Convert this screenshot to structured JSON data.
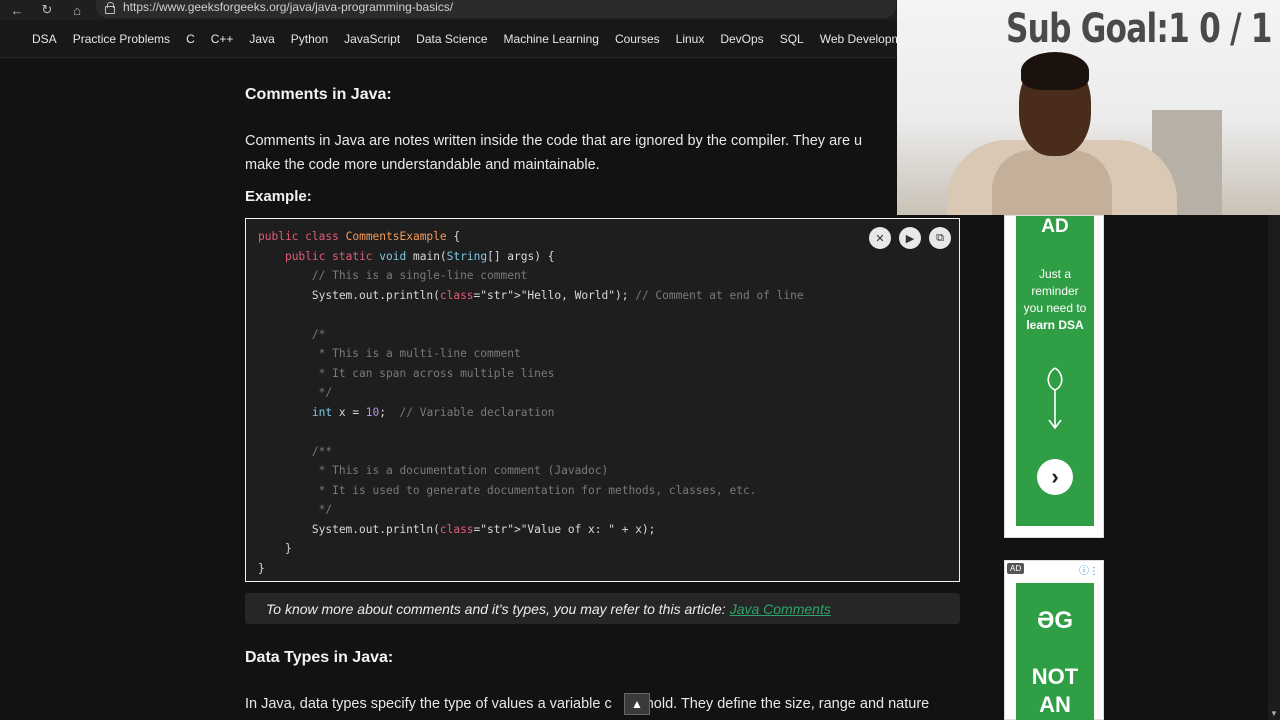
{
  "browser": {
    "url": "https://www.geeksforgeeks.org/java/java-programming-basics/",
    "back_icon": "arrow-left-icon",
    "reload_icon": "reload-icon",
    "home_icon": "home-icon"
  },
  "nav": {
    "items": [
      "DSA",
      "Practice Problems",
      "C",
      "C++",
      "Java",
      "Python",
      "JavaScript",
      "Data Science",
      "Machine Learning",
      "Courses",
      "Linux",
      "DevOps",
      "SQL",
      "Web Development"
    ]
  },
  "article": {
    "comments_heading": "Comments in Java:",
    "comments_para": "Comments in Java are notes written inside the code that are ignored by the compiler. They are u",
    "comments_para2": "make the code more understandable and maintainable.",
    "example_label": "Example:",
    "note_text": "To know more about comments and it's types, you may refer to this article:",
    "note_link": "Java Comments",
    "datatypes_heading": "Data Types in Java:",
    "datatypes_para_a": "In Java, data types specify the type of values a variable c",
    "datatypes_para_b": "hold. They define the size, range and nature"
  },
  "code": {
    "lines": [
      "public class CommentsExample {",
      "    public static void main(String[] args) {",
      "        // This is a single-line comment",
      "        System.out.println(\"Hello, World\"); // Comment at end of line",
      "",
      "        /*",
      "         * This is a multi-line comment",
      "         * It can span across multiple lines",
      "         */",
      "        int x = 10;  // Variable declaration",
      "",
      "        /**",
      "         * This is a documentation comment (Javadoc)",
      "         * It is used to generate documentation for methods, classes, etc.",
      "         */",
      "        System.out.println(\"Value of x: \" + x);",
      "    }",
      "}"
    ]
  },
  "code_buttons": {
    "close": "✕",
    "run": "▶",
    "copy": "⧉"
  },
  "ads": {
    "ad1_tag": "AD",
    "ad1_line1": "Just a",
    "ad1_line2": "reminder",
    "ad1_line3": "you need to",
    "ad1_line4": "learn DSA",
    "ad2_tag": "AD",
    "ad2_logo": "ƏG",
    "ad2_text1": "NOT",
    "ad2_text2": "AN"
  },
  "overlay": {
    "goal_text": "Sub Goal:1  0 / 1"
  },
  "scroll_top_label": "▲"
}
